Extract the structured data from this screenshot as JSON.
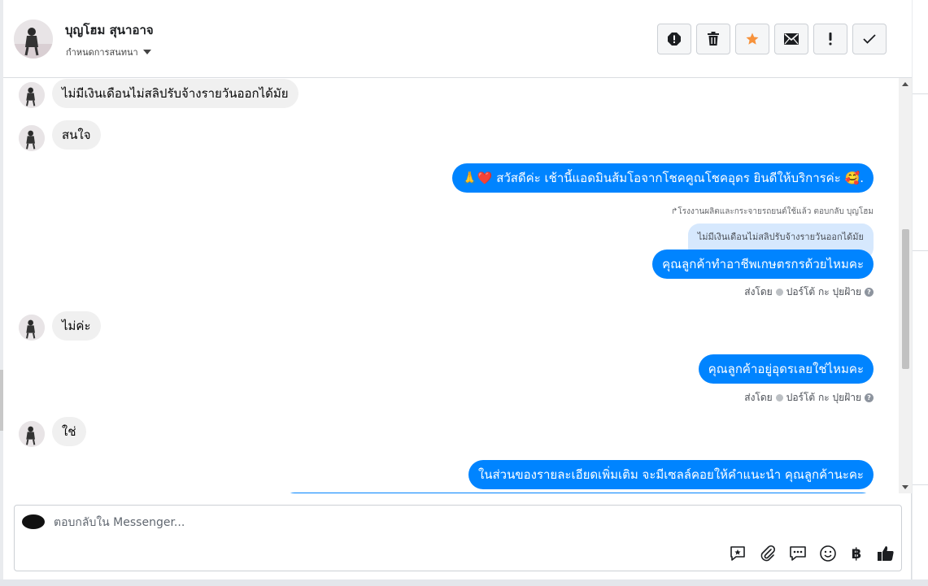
{
  "header": {
    "contact_name": "บุญโฮม สุนาอาจ",
    "assign_label": "กำหนดการสนทนา",
    "buttons": [
      {
        "name": "spam",
        "icon": "alert-circle-icon"
      },
      {
        "name": "delete",
        "icon": "trash-icon"
      },
      {
        "name": "star",
        "icon": "star-icon",
        "color": "#f7923b"
      },
      {
        "name": "mark-unread",
        "icon": "envelope-icon"
      },
      {
        "name": "follow-up",
        "icon": "exclamation-icon"
      },
      {
        "name": "done",
        "icon": "check-icon"
      }
    ]
  },
  "messages": {
    "m1": "ไม่มีเงินเดือนไม่สลิปรับจ้างรายวันออกได้มัย",
    "m2": "สนใจ",
    "m3": "🙏❤️ สวัสดีค่ะ เช้านี้แอดมินส้มโอจากโชคคูณโชคอุดร ยินดีให้บริการค่ะ 🥰.",
    "m4_reply_note": "↱โรงงานผลิตและกระจายรถยนต์ใช้แล้ว ตอบกลับ บุญโฮม",
    "m4_quoted": "ไม่มีเงินเดือนไม่สลิปรับจ้างรายวันออกได้มัย",
    "m4": "คุณลูกค้าทำอาชีพเกษตรกรด้วยไหมคะ",
    "m4_sentby": "ส่งโดย",
    "m4_agent": "ปอร์โต้ กะ ปุยฝ้าย",
    "m5": "ไม่ค่ะ",
    "m6": "คุณลูกค้าอยู่อุดรเลยใช่ไหมคะ",
    "m6_sentby": "ส่งโดย",
    "m6_agent": "ปอร์โต้ กะ ปุยฝ้าย",
    "m7": "ใช่",
    "m8": "ในส่วนของรายละเอียดเพิ่มเติม จะมีเซลล์คอยให้คำแนะนำ คุณลูกค้านะคะ"
  },
  "composer": {
    "placeholder": "ตอบกลับใน Messenger...",
    "tools": [
      "sticker-reply-icon",
      "attachment-icon",
      "saved-replies-icon",
      "emoji-icon",
      "baht-payment-icon",
      "thumbs-up-icon"
    ],
    "baht_symbol": "฿"
  },
  "colors": {
    "outgoing": "#0084ff",
    "incoming": "#f0f0f0",
    "quoted": "#d6e8fd"
  }
}
